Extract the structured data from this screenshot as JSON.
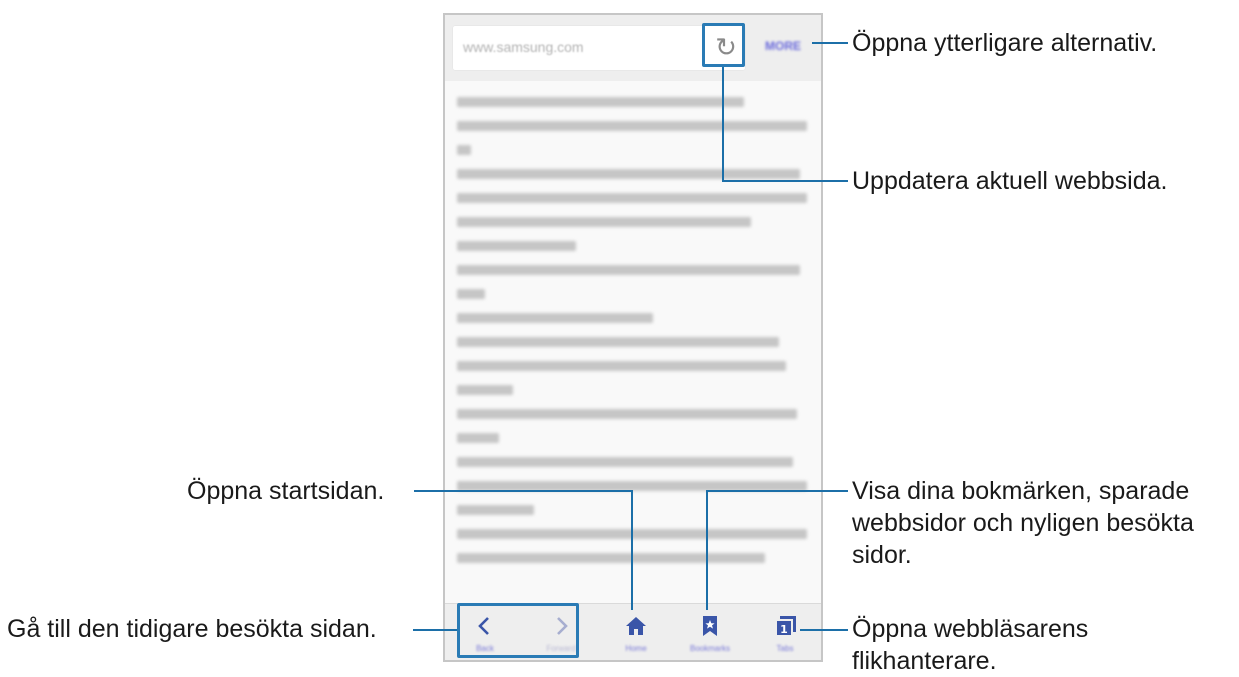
{
  "browser": {
    "url": "www.samsung.com",
    "more_label": "MORE",
    "reload_icon": "reload-icon",
    "nav": [
      {
        "id": "back",
        "label": "Back",
        "icon": "chevron-left-icon"
      },
      {
        "id": "forward",
        "label": "Forward",
        "icon": "chevron-right-icon"
      },
      {
        "id": "home",
        "label": "Home",
        "icon": "home-icon"
      },
      {
        "id": "bookmarks",
        "label": "Bookmarks",
        "icon": "bookmark-icon"
      },
      {
        "id": "tabs",
        "label": "Tabs",
        "icon": "tabs-icon",
        "count": "1"
      }
    ]
  },
  "annotations": {
    "more": "Öppna ytterligare alternativ.",
    "reload": "Uppdatera aktuell webbsida.",
    "home": "Öppna startsidan.",
    "bookmarks": [
      "Visa dina bokmärken, sparade",
      "webbsidor och nyligen besökta",
      "sidor."
    ],
    "back": "Gå till den tidigare besökta sidan.",
    "tabs": [
      "Öppna webbläsarens",
      "flikhanterare."
    ]
  },
  "colors": {
    "highlight": "#2a7bb5",
    "link_blue": "#6a6adb",
    "icon_blue": "#3a55a8"
  }
}
